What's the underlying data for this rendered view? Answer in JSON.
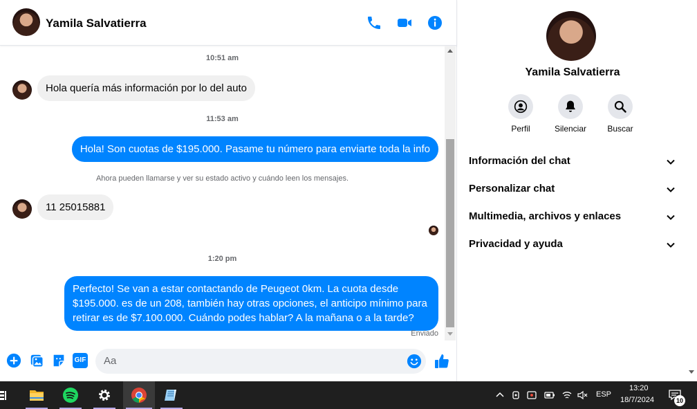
{
  "chat": {
    "contact_name": "Yamila Salvatierra",
    "composer_placeholder": "Aa",
    "sent_status": "Enviado",
    "messages": [
      {
        "type": "time",
        "text": "10:51 am"
      },
      {
        "type": "in",
        "text": "Hola quería más información por lo del auto"
      },
      {
        "type": "time",
        "text": "11:53 am"
      },
      {
        "type": "out",
        "text": "Hola! Son cuotas de $195.000. Pasame tu número para enviarte toda la info"
      },
      {
        "type": "notice",
        "text": "Ahora pueden llamarse y ver su estado activo y cuándo leen los mensajes."
      },
      {
        "type": "in",
        "text": "11 25015881"
      },
      {
        "type": "time",
        "text": "1:20 pm"
      },
      {
        "type": "out",
        "text": "Perfecto!  Se van a estar contactando de Peugeot 0km. La cuota desde $195.000. es de un 208, también hay otras opciones, el anticipo mínimo para retirar es de $7.100.000. Cuándo podes hablar? A la mañana o a la tarde?"
      }
    ],
    "composer_gif_label": "GIF"
  },
  "info_panel": {
    "name": "Yamila Salvatierra",
    "actions": [
      {
        "label": "Perfil",
        "icon": "profile-icon"
      },
      {
        "label": "Silenciar",
        "icon": "bell-icon"
      },
      {
        "label": "Buscar",
        "icon": "search-icon"
      }
    ],
    "sections": [
      "Información del chat",
      "Personalizar chat",
      "Multimedia, archivos y enlaces",
      "Privacidad y ayuda"
    ]
  },
  "taskbar": {
    "language": "ESP",
    "time": "13:20",
    "date": "18/7/2024",
    "notification_count": "10"
  },
  "colors": {
    "accent": "#0084ff",
    "bubble_in": "#f0f0f0",
    "taskbar": "#1f1f1f"
  }
}
